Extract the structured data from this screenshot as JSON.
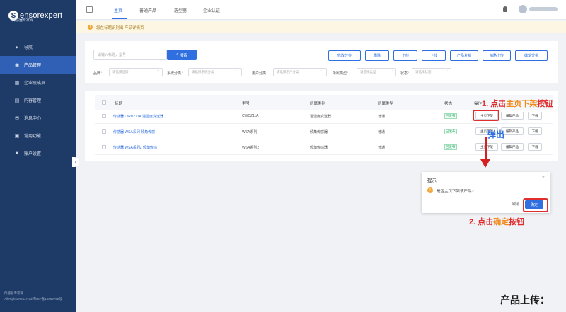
{
  "brand": {
    "name": "ensorexpert",
    "mark": "S",
    "subtitle": "传感器专家网"
  },
  "sidebar": {
    "items": [
      {
        "label": "导航",
        "icon": "send-icon"
      },
      {
        "label": "产品管理",
        "icon": "cube-icon",
        "active": true
      },
      {
        "label": "企业及成员",
        "icon": "building-icon"
      },
      {
        "label": "内容管理",
        "icon": "document-icon"
      },
      {
        "label": "消息中心",
        "icon": "message-icon"
      },
      {
        "label": "常用功能",
        "icon": "grid-icon"
      },
      {
        "label": "账户设置",
        "icon": "user-icon"
      }
    ],
    "footer_line1": "传感器专家网",
    "footer_line2": "All Rights Reserved 粤ICP备16062762号"
  },
  "topbar": {
    "tabs": [
      "主页",
      "普通产品",
      "选型器",
      "企业认证"
    ],
    "active_tab": "主页"
  },
  "notice": {
    "text": "您在标题识别出 产品详情页"
  },
  "toolbar": {
    "search_placeholder": "请输入标题，型号",
    "search_label": "搜索",
    "buttons": [
      "修改分类",
      "删除",
      "上线",
      "下线",
      "产品复制",
      "缩略上传",
      "编辑分类"
    ]
  },
  "filters": [
    {
      "label": "品牌：",
      "placeholder": "请选择品牌"
    },
    {
      "label": "系统分类：",
      "placeholder": "请选择系统分类"
    },
    {
      "label": "用户分类：",
      "placeholder": "请选择用户分类"
    },
    {
      "label": "所属类型：",
      "placeholder": "请选择类型"
    },
    {
      "label": "状态：",
      "placeholder": "请选择状态"
    }
  ],
  "table": {
    "headers": [
      "标题",
      "型号",
      "所属类别",
      "所属类型",
      "状态",
      "操作"
    ],
    "rows": [
      {
        "title": "传感器 CWDZ11A 温湿度变送器",
        "model": "CWDZ11A",
        "category": "温湿度变送器",
        "type": "普通",
        "status": "已发布",
        "actions": [
          "主页下架",
          "编辑产品",
          "下线"
        ]
      },
      {
        "title": "传感器 WSA系列 倾角传感",
        "model": "WSA系列",
        "category": "倾角传感器",
        "type": "普通",
        "status": "已发布",
        "actions": [
          "主页下架",
          "编辑产品",
          "下线"
        ]
      },
      {
        "title": "传感器 WSA系列2 倾角传感",
        "model": "WSA系列2",
        "category": "倾角传感器",
        "type": "普通",
        "status": "已发布",
        "actions": [
          "主页下架",
          "编辑产品",
          "下线"
        ]
      }
    ]
  },
  "annotations": {
    "step1_prefix": "1. 点击",
    "step1_highlight": "主页下架",
    "step1_suffix": "按钮",
    "popup": "弹出",
    "step2_prefix": "2. 点击",
    "step2_highlight": "确定",
    "step2_suffix": "按钮",
    "caption": "产品上传："
  },
  "dialog": {
    "title": "提示",
    "message": "是否主页下架该产品?",
    "cancel": "取消",
    "confirm": "确定",
    "close": "×"
  }
}
